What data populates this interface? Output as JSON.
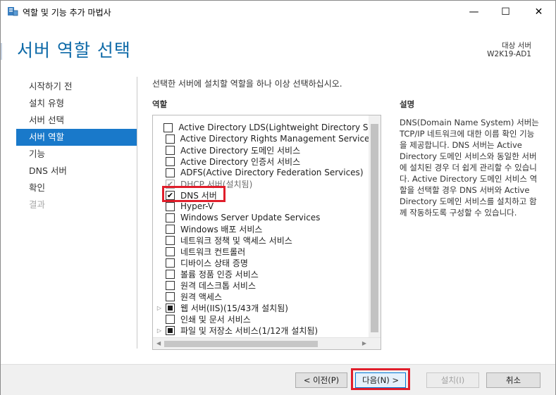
{
  "window": {
    "title": "역할 및 기능 추가 마법사",
    "minimize_glyph": "—",
    "maximize_glyph": "☐",
    "close_glyph": "✕"
  },
  "header": {
    "title": "서버 역할 선택",
    "target_label": "대상 서버",
    "target_server": "W2K19-AD1"
  },
  "nav": {
    "items": [
      {
        "label": "시작하기 전",
        "state": "normal"
      },
      {
        "label": "설치 유형",
        "state": "normal"
      },
      {
        "label": "서버 선택",
        "state": "normal"
      },
      {
        "label": "서버 역할",
        "state": "active"
      },
      {
        "label": "기능",
        "state": "normal"
      },
      {
        "label": "DNS 서버",
        "state": "normal"
      },
      {
        "label": "확인",
        "state": "normal"
      },
      {
        "label": "결과",
        "state": "disabled"
      }
    ]
  },
  "main": {
    "instruction": "선택한 서버에 설치할 역할을 하나 이상 선택하십시오.",
    "roles_heading": "역할",
    "description_heading": "설명",
    "description_text": "DNS(Domain Name System) 서버는 TCP/IP 네트워크에 대한 이름 확인 기능을 제공합니다. DNS 서버는 Active Directory 도메인 서비스와 동일한 서버에 설치된 경우 더 쉽게 관리할 수 있습니다. Active Directory 도메인 서비스 역할을 선택할 경우 DNS 서버와 Active Directory 도메인 서비스를 설치하고 함께 작동하도록 구성할 수 있습니다.",
    "roles": [
      {
        "label": "Active Directory LDS(Lightweight Directory Services)",
        "state": "unchecked",
        "expander": false
      },
      {
        "label": "Active Directory Rights Management Services",
        "state": "unchecked",
        "expander": false
      },
      {
        "label": "Active Directory 도메인 서비스",
        "state": "unchecked",
        "expander": false
      },
      {
        "label": "Active Directory 인증서 서비스",
        "state": "unchecked",
        "expander": false
      },
      {
        "label": "ADFS(Active Directory Federation Services)",
        "state": "unchecked",
        "expander": false
      },
      {
        "label": "DHCP 서버(설치됨)",
        "state": "installed",
        "expander": false
      },
      {
        "label": "DNS 서버",
        "state": "checked",
        "expander": false
      },
      {
        "label": "Hyper-V",
        "state": "unchecked",
        "expander": false
      },
      {
        "label": "Windows Server Update Services",
        "state": "unchecked",
        "expander": false
      },
      {
        "label": "Windows 배포 서비스",
        "state": "unchecked",
        "expander": false
      },
      {
        "label": "네트워크 정책 및 액세스 서비스",
        "state": "unchecked",
        "expander": false
      },
      {
        "label": "네트워크 컨트롤러",
        "state": "unchecked",
        "expander": false
      },
      {
        "label": "디바이스 상태 증명",
        "state": "unchecked",
        "expander": false
      },
      {
        "label": "볼륨 정품 인증 서비스",
        "state": "unchecked",
        "expander": false
      },
      {
        "label": "원격 데스크톱 서비스",
        "state": "unchecked",
        "expander": false
      },
      {
        "label": "원격 액세스",
        "state": "unchecked",
        "expander": false
      },
      {
        "label": "웹 서버(IIS)(15/43개 설치됨)",
        "state": "partial",
        "expander": true
      },
      {
        "label": "인쇄 및 문서 서비스",
        "state": "unchecked",
        "expander": false
      },
      {
        "label": "파일 및 저장소 서비스(1/12개 설치됨)",
        "state": "partial",
        "expander": true
      }
    ]
  },
  "footer": {
    "prev_label": "< 이전(P)",
    "next_label": "다음(N) >",
    "install_label": "설치(I)",
    "cancel_label": "취소"
  },
  "colors": {
    "accent": "#1979ca",
    "title_blue": "#0e6aa8",
    "highlight_red": "#e01e2b"
  }
}
